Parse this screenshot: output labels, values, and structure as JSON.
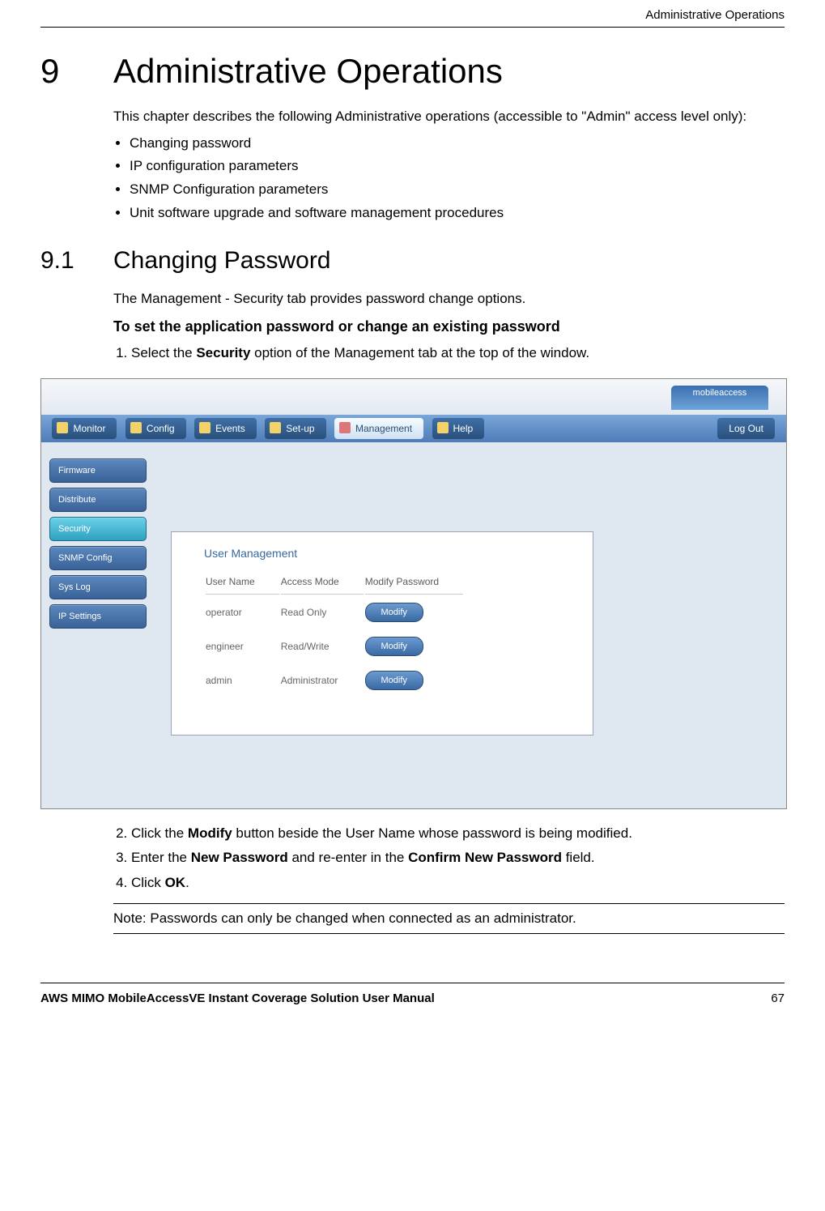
{
  "header": {
    "right_title": "Administrative Operations"
  },
  "h1": {
    "num": "9",
    "text": "Administrative Operations"
  },
  "intro": "This chapter describes the following Administrative operations (accessible to \"Admin\" access level only):",
  "bullets": [
    "Changing password",
    "IP configuration parameters",
    "SNMP Configuration parameters",
    "Unit software upgrade and software management procedures"
  ],
  "h2": {
    "num": "9.1",
    "text": "Changing Password"
  },
  "p2": "The Management - Security tab provides password change options.",
  "boldline": "To set the application password or change an existing password",
  "step1_pre": "Select the ",
  "step1_bold": "Security",
  "step1_post": " option of the Management tab at the top of the window.",
  "screenshot": {
    "brand": "mobileaccess",
    "tabs": [
      "Monitor",
      "Config",
      "Events",
      "Set-up",
      "Management",
      "Help"
    ],
    "active_tab_index": 4,
    "logout": "Log Out",
    "sidebar": [
      "Firmware",
      "Distribute",
      "Security",
      "SNMP Config",
      "Sys Log",
      "IP Settings"
    ],
    "active_side_index": 2,
    "panel_title": "User Management",
    "columns": [
      "User Name",
      "Access Mode",
      "Modify Password"
    ],
    "rows": [
      {
        "user": "operator",
        "mode": "Read Only",
        "btn": "Modify"
      },
      {
        "user": "engineer",
        "mode": "Read/Write",
        "btn": "Modify"
      },
      {
        "user": "admin",
        "mode": "Administrator",
        "btn": "Modify"
      }
    ]
  },
  "step2_pre": "Click the ",
  "step2_bold": "Modify",
  "step2_post": " button beside the User Name whose password is being modified.",
  "step3_pre": "Enter the ",
  "step3_bold1": "New Password",
  "step3_mid": " and re-enter in the ",
  "step3_bold2": "Confirm New Password",
  "step3_post": " field.",
  "step4_pre": "Click ",
  "step4_bold": "OK",
  "step4_post": ".",
  "note": "Note: Passwords can only be changed when connected as an administrator.",
  "footer": {
    "left": "AWS MIMO MobileAccessVE Instant Coverage Solution User Manual",
    "right": "67"
  }
}
